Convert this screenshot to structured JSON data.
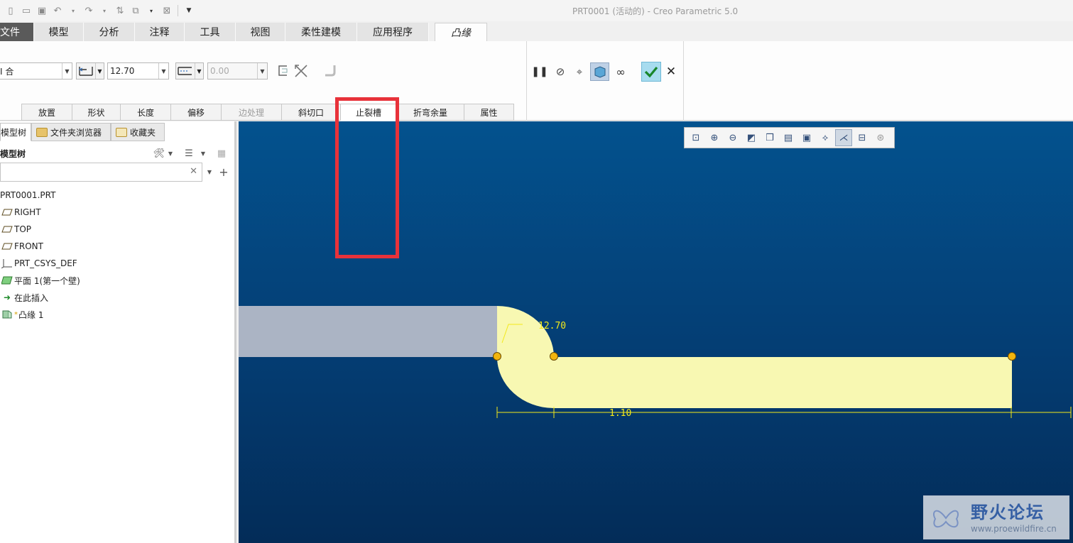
{
  "window": {
    "title": "PRT0001 (活动的) - Creo Parametric 5.0"
  },
  "quick_access": [
    "new-icon",
    "open-icon",
    "save-icon",
    "undo-icon",
    "redo-icon",
    "regenerate-icon",
    "windows-icon",
    "close-window-icon",
    "customize-icon"
  ],
  "ribbon": {
    "tabs": [
      {
        "label": "文件",
        "name": "tab-file"
      },
      {
        "label": "模型",
        "name": "tab-model"
      },
      {
        "label": "分析",
        "name": "tab-analysis"
      },
      {
        "label": "注释",
        "name": "tab-annotate"
      },
      {
        "label": "工具",
        "name": "tab-tools"
      },
      {
        "label": "视图",
        "name": "tab-view"
      },
      {
        "label": "柔性建模",
        "name": "tab-flexible-modeling"
      },
      {
        "label": "应用程序",
        "name": "tab-applications"
      },
      {
        "label": "凸缘",
        "name": "tab-flange"
      }
    ],
    "shape_combo": {
      "value": "I 合"
    },
    "length_value": "12.70",
    "offset_value": "0.00",
    "subtabs": [
      {
        "label": "放置",
        "name": "subtab-placement",
        "disabled": false
      },
      {
        "label": "形状",
        "name": "subtab-shape",
        "disabled": false
      },
      {
        "label": "长度",
        "name": "subtab-length",
        "disabled": false
      },
      {
        "label": "偏移",
        "name": "subtab-offset",
        "disabled": false
      },
      {
        "label": "边处理",
        "name": "subtab-edge-treatment",
        "disabled": true
      },
      {
        "label": "斜切口",
        "name": "subtab-miter-cuts",
        "disabled": false
      },
      {
        "label": "止裂槽",
        "name": "subtab-relief",
        "disabled": false,
        "active": true
      },
      {
        "label": "折弯余量",
        "name": "subtab-bend-allowance",
        "disabled": false
      },
      {
        "label": "属性",
        "name": "subtab-properties",
        "disabled": false
      }
    ],
    "actions": [
      "pause-icon",
      "no-preview-icon",
      "verify-icon",
      "preview-icon",
      "glasses-icon",
      "ok-icon",
      "cancel-icon"
    ]
  },
  "navigator": {
    "tabs": [
      {
        "label": "模型树",
        "name": "nav-tab-model-tree"
      },
      {
        "label": "文件夹浏览器",
        "name": "nav-tab-folder-browser"
      },
      {
        "label": "收藏夹",
        "name": "nav-tab-favorites"
      }
    ],
    "tree_title": "模型树",
    "search_placeholder": "",
    "items": [
      {
        "label": "PRT0001.PRT",
        "icon": "part-icon"
      },
      {
        "label": "RIGHT",
        "icon": "datum-plane-icon"
      },
      {
        "label": "TOP",
        "icon": "datum-plane-icon"
      },
      {
        "label": "FRONT",
        "icon": "datum-plane-icon"
      },
      {
        "label": "PRT_CSYS_DEF",
        "icon": "csys-icon"
      },
      {
        "label": "平面 1(第一个壁)",
        "icon": "planar-wall-icon"
      },
      {
        "label": "在此插入",
        "icon": "insert-here-icon"
      },
      {
        "label": "凸缘 1",
        "icon": "flange-icon"
      }
    ]
  },
  "graphics": {
    "dim_radius": "12.70",
    "dim_length": "1.10",
    "colors": {
      "wall": "#abb4c4",
      "preview": "#f8f8b2",
      "dimension": "#f3e91a",
      "handle": "#f2b50e"
    }
  },
  "view_toolbar": [
    "refit-icon",
    "zoom-in-icon",
    "zoom-out-icon",
    "repaint-icon",
    "display-style-icon",
    "saved-orientations-icon",
    "view-manager-icon",
    "perspective-icon",
    "datum-display-icon",
    "annotation-display-icon",
    "spin-center-icon"
  ],
  "watermark": {
    "title": "野火论坛",
    "url": "www.proewildfire.cn"
  }
}
